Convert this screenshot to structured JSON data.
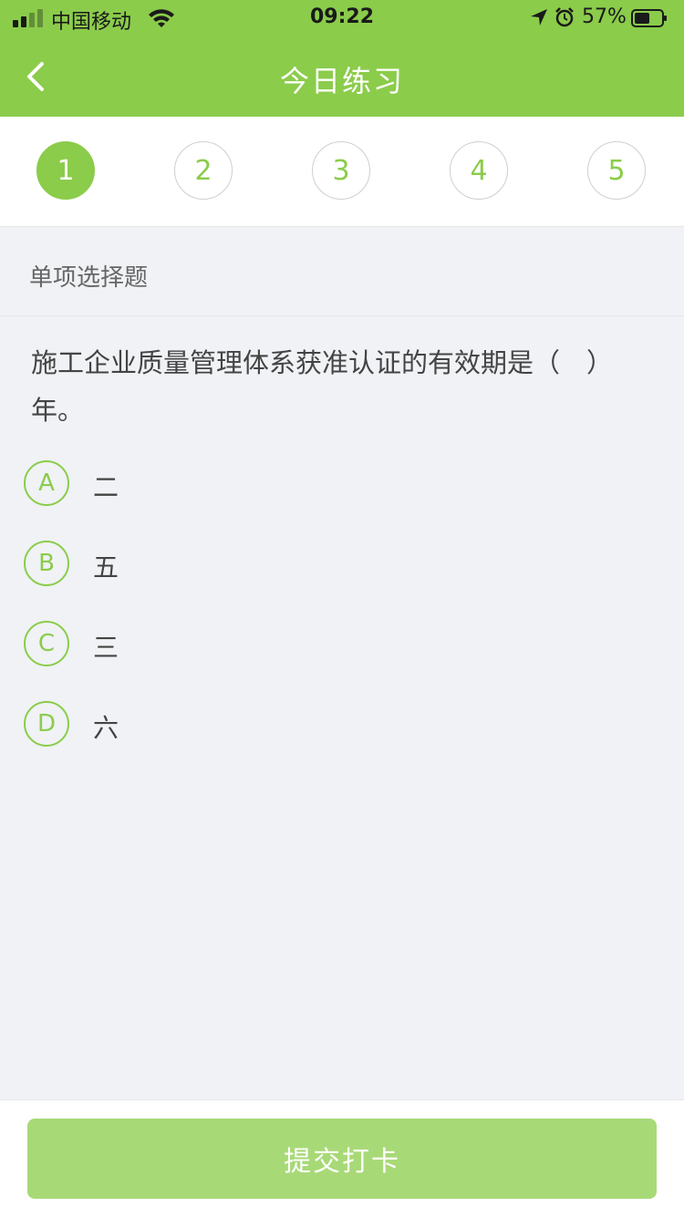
{
  "status_bar": {
    "carrier": "中国移动",
    "time": "09:22",
    "battery_percent": "57%",
    "battery_level": 0.57
  },
  "header": {
    "title": "今日练习",
    "back_icon": "chevron-left-icon"
  },
  "question_nav": {
    "items": [
      "1",
      "2",
      "3",
      "4",
      "5"
    ],
    "active_index": 0
  },
  "section": {
    "label": "单项选择题"
  },
  "question": {
    "text": "施工企业质量管理体系获准认证的有效期是（　）年。",
    "options": [
      {
        "letter": "A",
        "text": "二"
      },
      {
        "letter": "B",
        "text": "五"
      },
      {
        "letter": "C",
        "text": "三"
      },
      {
        "letter": "D",
        "text": "六"
      }
    ]
  },
  "footer": {
    "submit_label": "提交打卡"
  },
  "colors": {
    "brand_green": "#8bcc4b",
    "submit_green": "#a8d977",
    "background": "#f0f2f5"
  }
}
